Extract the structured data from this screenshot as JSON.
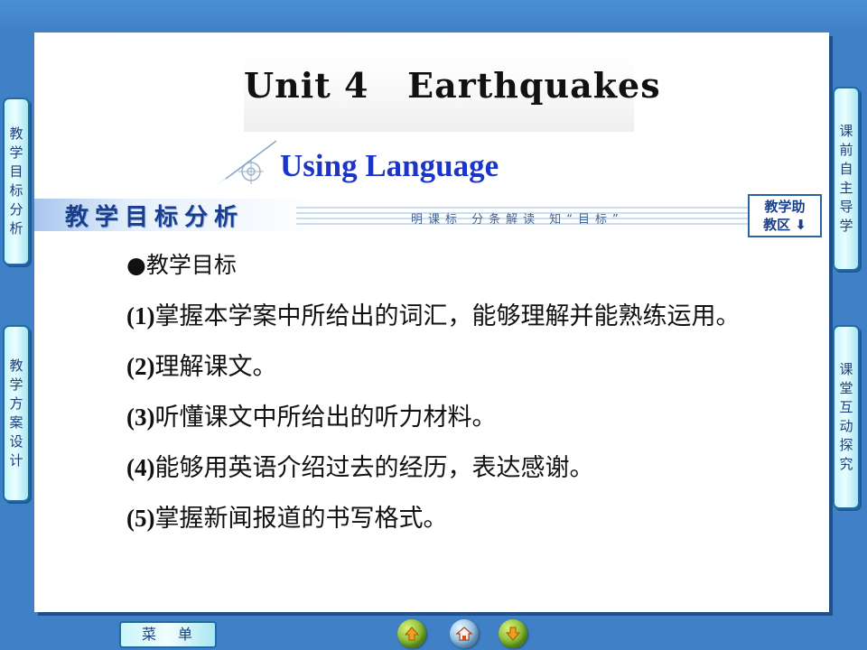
{
  "colors": {
    "background": "#3f80c6",
    "card": "#ffffff",
    "subtitle": "#1b35c8",
    "tab": "#c7f6fb",
    "accent": "#1f6aa8"
  },
  "left_tabs": [
    {
      "label": "教学目标分析"
    },
    {
      "label": "教学方案设计"
    }
  ],
  "right_tabs": [
    {
      "label": "课前自主导学"
    },
    {
      "label": "课堂互动探究"
    }
  ],
  "header": {
    "title": "Unit 4   Earthquakes",
    "subtitle": "Using Language"
  },
  "section": {
    "title": "教学目标分析",
    "hint": "明课标 分条解读 知“目标”",
    "help_button_line1": "教学助",
    "help_button_line2": "教区 ⬇"
  },
  "objectives": {
    "heading": "●教学目标",
    "items": [
      {
        "num": "(1)",
        "text": "掌握本学案中所给出的词汇，能够理解并能熟练运用。"
      },
      {
        "num": "(2)",
        "text": "理解课文。"
      },
      {
        "num": "(3)",
        "text": "听懂课文中所给出的听力材料。"
      },
      {
        "num": "(4)",
        "text": "能够用英语介绍过去的经历，表达感谢。"
      },
      {
        "num": "(5)",
        "text": "掌握新闻报道的书写格式。"
      }
    ]
  },
  "bottom_nav": {
    "menu_label": "菜单",
    "buttons": [
      "previous-icon",
      "home-icon",
      "next-icon"
    ]
  }
}
